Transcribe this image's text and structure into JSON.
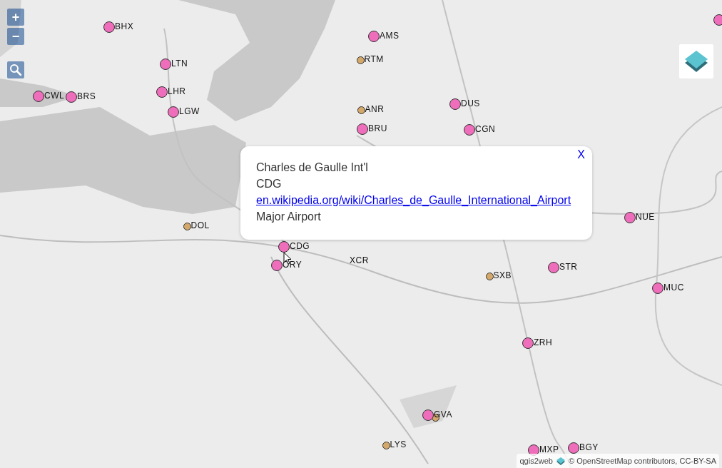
{
  "zoom_controls": {
    "zoom_in": "+",
    "zoom_out": "−"
  },
  "airports": [
    {
      "code": "BHX",
      "kind": "major"
    },
    {
      "code": "AMS",
      "kind": "major"
    },
    {
      "code": "RTM",
      "kind": "minor"
    },
    {
      "code": "LTN",
      "kind": "major"
    },
    {
      "code": "CWL",
      "kind": "major"
    },
    {
      "code": "BRS",
      "kind": "major"
    },
    {
      "code": "LHR",
      "kind": "major"
    },
    {
      "code": "LGW",
      "kind": "major"
    },
    {
      "code": "ANR",
      "kind": "minor"
    },
    {
      "code": "DUS",
      "kind": "major"
    },
    {
      "code": "BRU",
      "kind": "major"
    },
    {
      "code": "CGN",
      "kind": "major"
    },
    {
      "code": "DOL",
      "kind": "minor"
    },
    {
      "code": "CDG",
      "kind": "major"
    },
    {
      "code": "ORY",
      "kind": "major"
    },
    {
      "code": "XCR",
      "kind": "unmarked"
    },
    {
      "code": "SXB",
      "kind": "minor"
    },
    {
      "code": "STR",
      "kind": "major"
    },
    {
      "code": "NUE",
      "kind": "major"
    },
    {
      "code": "MUC",
      "kind": "major"
    },
    {
      "code": "ZRH",
      "kind": "major"
    },
    {
      "kind": "minor"
    },
    {
      "code": "GVA",
      "kind": "major"
    },
    {
      "code": "LYS",
      "kind": "minor"
    },
    {
      "code": "MXP",
      "kind": "major"
    },
    {
      "code": "BGY",
      "kind": "major"
    },
    {
      "kind": "major"
    }
  ],
  "popup": {
    "close": "X",
    "name": "Charles de Gaulle Int'l",
    "code": "CDG",
    "link": "en.wikipedia.org/wiki/Charles_de_Gaulle_International_Airport",
    "category": "Major Airport"
  },
  "attribution": {
    "app_link": "qgis2web",
    "prefix": "© ",
    "osm_link": "OpenStreetMap",
    "suffix": " contributors, CC-BY-SA"
  }
}
